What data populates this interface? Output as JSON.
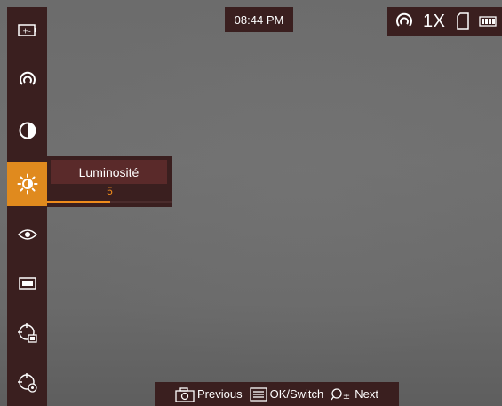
{
  "status_top": {
    "time": "08:44 PM",
    "zoom": "1X",
    "icons": [
      "hotspot-tracking-icon",
      "sd-card-icon",
      "battery-icon"
    ]
  },
  "sidebar": {
    "items": [
      {
        "name": "image-mode-icon",
        "active": false
      },
      {
        "name": "hotspot-icon",
        "active": false
      },
      {
        "name": "contrast-icon",
        "active": false
      },
      {
        "name": "brightness-icon",
        "active": true
      },
      {
        "name": "scene-mode-icon",
        "active": false
      },
      {
        "name": "screen-mode-icon",
        "active": false
      },
      {
        "name": "ranging-settings-icon",
        "active": false
      },
      {
        "name": "function-settings-icon",
        "active": false
      }
    ]
  },
  "submenu": {
    "title": "Luminosité",
    "value": "5",
    "level_fraction": 0.5
  },
  "bottom_hint": {
    "previous_label": "Previous",
    "ok_label": "OK/Switch",
    "next_label": "Next"
  },
  "colors": {
    "panel": "#3a1f1f",
    "accent": "#e08a1e",
    "value_orange": "#f08c1c",
    "background_gray": "#6c6c6c"
  }
}
